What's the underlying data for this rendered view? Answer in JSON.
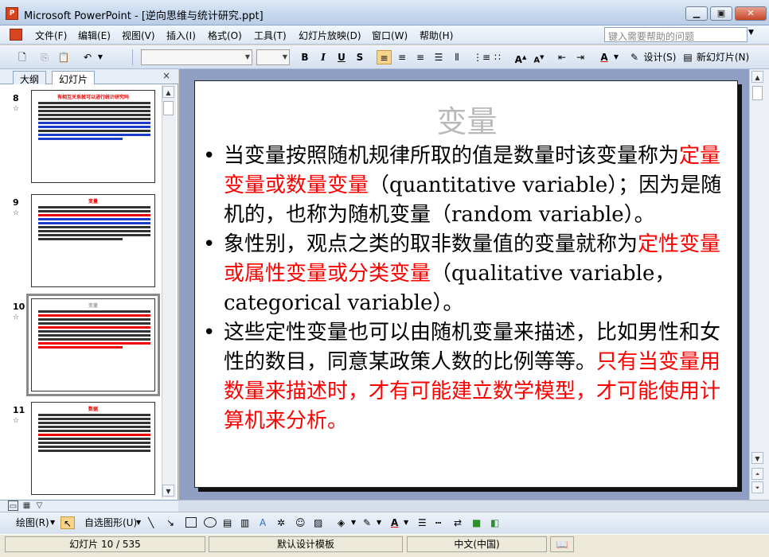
{
  "window": {
    "title": "Microsoft PowerPoint - [逆向思维与统计研究.ppt]",
    "app_icon": "P"
  },
  "menubar": {
    "items": [
      "文件(F)",
      "编辑(E)",
      "视图(V)",
      "插入(I)",
      "格式(O)",
      "工具(T)",
      "幻灯片放映(D)",
      "窗口(W)",
      "帮助(H)"
    ],
    "help_placeholder": "键入需要帮助的问题"
  },
  "toolbar": {
    "bold": "B",
    "italic": "I",
    "underline": "U",
    "shadow": "S",
    "design_label": "设计(S)",
    "new_slide_label": "新幻灯片(N)"
  },
  "left_pane": {
    "tabs": [
      "大纲",
      "幻灯片"
    ],
    "active_tab": "幻灯片",
    "close_glyph": "×",
    "thumbnails": [
      {
        "number": "8",
        "title": "有相互关系就可以进行统计研究吗",
        "selected": false
      },
      {
        "number": "9",
        "title": "变量",
        "selected": false
      },
      {
        "number": "10",
        "title": "变量",
        "selected": true
      },
      {
        "number": "11",
        "title": "数据",
        "selected": false
      }
    ]
  },
  "slide": {
    "title": "变量",
    "bullets": [
      [
        {
          "text": "当变量按照随机规律所取的值是数量时该变量称为",
          "color": "black"
        },
        {
          "text": "定量变量或数量变量",
          "color": "red"
        },
        {
          "text": "（quantitative variable）；因为是随机的，也称为随机变量（random variable）。",
          "color": "black"
        }
      ],
      [
        {
          "text": "象性别，观点之类的取非数量值的变量就称为",
          "color": "black"
        },
        {
          "text": "定性变量或属性变量或分类变量",
          "color": "red"
        },
        {
          "text": "（qualitative variable，categorical variable）。",
          "color": "black"
        }
      ],
      [
        {
          "text": "这些定性变量也可以由随机变量来描述，比如男性和女性的数目，同意某政策人数的比例等等。",
          "color": "black"
        },
        {
          "text": "只有当变量用数量来描述时，才有可能建立数学模型，才可能使用计算机来分析。",
          "color": "red"
        }
      ]
    ]
  },
  "drawbar": {
    "draw_label": "绘图(R)",
    "autoshape_label": "自选图形(U)"
  },
  "statusbar": {
    "slide_position": "幻灯片 10 / 535",
    "design_template": "默认设计模板",
    "language": "中文(中国)"
  },
  "colors": {
    "accent_red": "#ff0000",
    "edit_bg": "#8f9fc3",
    "title_gray": "#b9b9b9"
  }
}
